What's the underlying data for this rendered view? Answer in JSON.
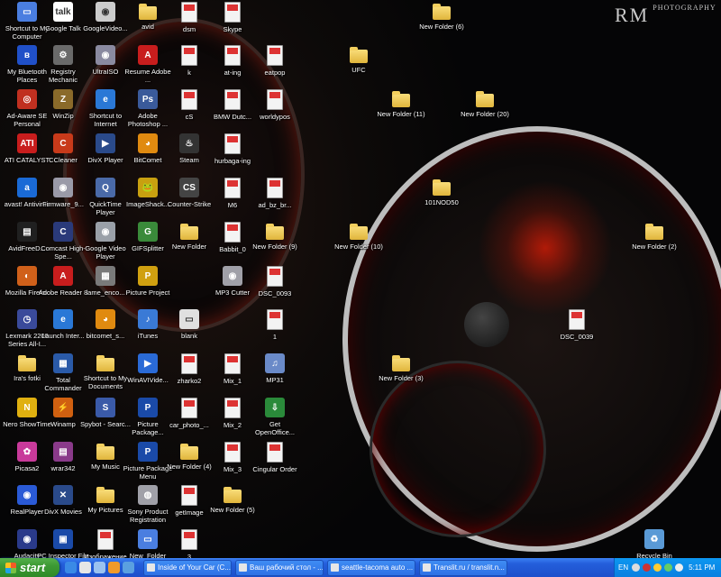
{
  "watermark": {
    "main": "RM",
    "sub": "PHOTOGRAPHY"
  },
  "desktop_icons": [
    {
      "label": "Shortcut to My Computer",
      "icon": "computer-icon",
      "glyph": "▭",
      "color": "#4a7ee0"
    },
    {
      "label": "Google Talk",
      "icon": "google-talk-icon",
      "glyph": "talk",
      "color": "#ffffff"
    },
    {
      "label": "GoogleVideo...",
      "icon": "google-video-icon",
      "glyph": "◉",
      "color": "#cccccc"
    },
    {
      "label": "avid",
      "icon": "folder-icon",
      "glyph": "folder",
      "color": ""
    },
    {
      "label": "dsm",
      "icon": "image-file-icon",
      "glyph": "doc",
      "color": ""
    },
    {
      "label": "Skype",
      "icon": "image-file-icon",
      "glyph": "doc",
      "color": ""
    },
    {
      "label": "New Folder (6)",
      "icon": "folder-icon",
      "glyph": "folder",
      "color": ""
    },
    {
      "label": "My Bluetooth Places",
      "icon": "bluetooth-icon",
      "glyph": "ʙ",
      "color": "#2050c8"
    },
    {
      "label": "Registry Mechanic",
      "icon": "registry-mechanic-icon",
      "glyph": "⚙",
      "color": "#6a6a6a"
    },
    {
      "label": "UltraISO",
      "icon": "ultraiso-icon",
      "glyph": "◉",
      "color": "#8a8aa0"
    },
    {
      "label": "Resume Adobe ...",
      "icon": "pdf-icon",
      "glyph": "A",
      "color": "#c81d1d"
    },
    {
      "label": "k",
      "icon": "image-file-icon",
      "glyph": "doc",
      "color": ""
    },
    {
      "label": "at-ing",
      "icon": "image-file-icon",
      "glyph": "doc",
      "color": ""
    },
    {
      "label": "eatpop",
      "icon": "image-file-icon",
      "glyph": "doc",
      "color": ""
    },
    {
      "label": "UFC",
      "icon": "folder-icon",
      "glyph": "folder",
      "color": ""
    },
    {
      "label": "Ad-Aware SE Personal",
      "icon": "ad-aware-icon",
      "glyph": "◎",
      "color": "#c03020"
    },
    {
      "label": "WinZip",
      "icon": "winzip-icon",
      "glyph": "Z",
      "color": "#8a6a2a"
    },
    {
      "label": "Shortcut to Internet",
      "icon": "internet-explorer-icon",
      "glyph": "e",
      "color": "#2a78d6"
    },
    {
      "label": "Adobe Photoshop ...",
      "icon": "photoshop-icon",
      "glyph": "Ps",
      "color": "#3a5a9a"
    },
    {
      "label": "cS",
      "icon": "image-file-icon",
      "glyph": "doc",
      "color": ""
    },
    {
      "label": "BMW Dutc...",
      "icon": "image-file-icon",
      "glyph": "doc",
      "color": ""
    },
    {
      "label": "worldypos",
      "icon": "image-file-icon",
      "glyph": "doc",
      "color": ""
    },
    {
      "label": "New Folder (11)",
      "icon": "folder-icon",
      "glyph": "folder",
      "color": ""
    },
    {
      "label": "New Folder (20)",
      "icon": "folder-icon",
      "glyph": "folder",
      "color": ""
    },
    {
      "label": "ATI CATALYST",
      "icon": "ati-catalyst-icon",
      "glyph": "ATI",
      "color": "#c81d1d"
    },
    {
      "label": "CCleaner",
      "icon": "ccleaner-icon",
      "glyph": "C",
      "color": "#c83a1a"
    },
    {
      "label": "DivX Player",
      "icon": "divx-icon",
      "glyph": "▶",
      "color": "#2a4a8a"
    },
    {
      "label": "BitComet",
      "icon": "bitcomet-icon",
      "glyph": "◕",
      "color": "#e08a10"
    },
    {
      "label": "Steam",
      "icon": "steam-icon",
      "glyph": "♨",
      "color": "#333333"
    },
    {
      "label": "hurbaga-ing",
      "icon": "image-file-icon",
      "glyph": "doc",
      "color": ""
    },
    {
      "label": "avast! Antivirus",
      "icon": "avast-icon",
      "glyph": "a",
      "color": "#1a6ad6"
    },
    {
      "label": "Firmware_9...",
      "icon": "firmware-icon",
      "glyph": "◉",
      "color": "#9a9aa8"
    },
    {
      "label": "QuickTime Player",
      "icon": "quicktime-icon",
      "glyph": "Q",
      "color": "#4a6aa8"
    },
    {
      "label": "ImageShack...",
      "icon": "imageshack-icon",
      "glyph": "🐸",
      "color": "#c8a010"
    },
    {
      "label": "Counter-Strike",
      "icon": "counter-strike-icon",
      "glyph": "CS",
      "color": "#444444"
    },
    {
      "label": "M6",
      "icon": "image-file-icon",
      "glyph": "doc",
      "color": ""
    },
    {
      "label": "ad_bz_br...",
      "icon": "image-file-icon",
      "glyph": "doc",
      "color": ""
    },
    {
      "label": "101NOD50",
      "icon": "folder-icon",
      "glyph": "folder",
      "color": ""
    },
    {
      "label": "AvidFreeD...",
      "icon": "avid-icon",
      "glyph": "▤",
      "color": "#202020"
    },
    {
      "label": "Comcast High-Spe...",
      "icon": "comcast-icon",
      "glyph": "C",
      "color": "#2a3a7a"
    },
    {
      "label": "Google Video Player",
      "icon": "google-video-player-icon",
      "glyph": "◉",
      "color": "#9aa0a8"
    },
    {
      "label": "GIFSplitter",
      "icon": "gifsplitter-icon",
      "glyph": "G",
      "color": "#3a8a3a"
    },
    {
      "label": "New Folder",
      "icon": "folder-icon",
      "glyph": "folder",
      "color": ""
    },
    {
      "label": "Babbit_0",
      "icon": "image-file-icon",
      "glyph": "doc",
      "color": ""
    },
    {
      "label": "New Folder (9)",
      "icon": "folder-icon",
      "glyph": "folder",
      "color": ""
    },
    {
      "label": "New Folder (10)",
      "icon": "folder-icon",
      "glyph": "folder",
      "color": ""
    },
    {
      "label": "New Folder (2)",
      "icon": "folder-icon",
      "glyph": "folder",
      "color": ""
    },
    {
      "label": "Mozilla Firefox",
      "icon": "firefox-icon",
      "glyph": "◐",
      "color": "#d0601a"
    },
    {
      "label": "Adobe Reader 8",
      "icon": "adobe-reader-icon",
      "glyph": "A",
      "color": "#c81d1d"
    },
    {
      "label": "lame_enco...",
      "icon": "lame-icon",
      "glyph": "▦",
      "color": "#7a7a7a"
    },
    {
      "label": "Picture Project",
      "icon": "picture-project-icon",
      "glyph": "P",
      "color": "#d0a010"
    },
    {
      "label": "MP3 Cutter",
      "icon": "mp3-cutter-icon",
      "glyph": "◉",
      "color": "#a0a0a8"
    },
    {
      "label": "DSC_0093",
      "icon": "image-file-icon",
      "glyph": "doc",
      "color": ""
    },
    {
      "label": "Lexmark 2200 Series All-I...",
      "icon": "lexmark-icon",
      "glyph": "◷",
      "color": "#3a4a9a"
    },
    {
      "label": "Launch Inter...",
      "icon": "launch-internet-icon",
      "glyph": "e",
      "color": "#2a78d6"
    },
    {
      "label": "bitcomet_s...",
      "icon": "bitcomet-setup-icon",
      "glyph": "◕",
      "color": "#e08a10"
    },
    {
      "label": "iTunes",
      "icon": "itunes-icon",
      "glyph": "♪",
      "color": "#3a7ad6"
    },
    {
      "label": "blank",
      "icon": "blank-file-icon",
      "glyph": "▭",
      "color": "#e0e0e0"
    },
    {
      "label": "1",
      "icon": "image-file-icon",
      "glyph": "doc",
      "color": ""
    },
    {
      "label": "DSC_0039",
      "icon": "image-file-icon",
      "glyph": "doc",
      "color": ""
    },
    {
      "label": "Ira's fotki",
      "icon": "folder-icon",
      "glyph": "folder",
      "color": ""
    },
    {
      "label": "Total Commander",
      "icon": "total-commander-icon",
      "glyph": "▦",
      "color": "#2a5aa8"
    },
    {
      "label": "Shortcut to My Documents",
      "icon": "my-documents-icon",
      "glyph": "folder",
      "color": ""
    },
    {
      "label": "WinAVIVide...",
      "icon": "winavi-icon",
      "glyph": "▶",
      "color": "#2a6ad6"
    },
    {
      "label": "zharko2",
      "icon": "image-file-icon",
      "glyph": "doc",
      "color": ""
    },
    {
      "label": "Mix_1",
      "icon": "image-file-icon",
      "glyph": "doc",
      "color": ""
    },
    {
      "label": "MP31",
      "icon": "audio-file-icon",
      "glyph": "♫",
      "color": "#6a8ac8"
    },
    {
      "label": "New Folder (3)",
      "icon": "folder-icon",
      "glyph": "folder",
      "color": ""
    },
    {
      "label": "Nero ShowTime",
      "icon": "nero-icon",
      "glyph": "N",
      "color": "#e0b010"
    },
    {
      "label": "Winamp",
      "icon": "winamp-icon",
      "glyph": "⚡",
      "color": "#d06010"
    },
    {
      "label": "Spybot - Searc...",
      "icon": "spybot-icon",
      "glyph": "S",
      "color": "#3a5aa8"
    },
    {
      "label": "Picture Package...",
      "icon": "picture-package-icon",
      "glyph": "P",
      "color": "#1a4aa8"
    },
    {
      "label": "car_photo_...",
      "icon": "image-file-icon",
      "glyph": "doc",
      "color": ""
    },
    {
      "label": "Mix_2",
      "icon": "image-file-icon",
      "glyph": "doc",
      "color": ""
    },
    {
      "label": "Get OpenOffice...",
      "icon": "openoffice-icon",
      "glyph": "⇩",
      "color": "#2a8a3a"
    },
    {
      "label": "Picasa2",
      "icon": "picasa-icon",
      "glyph": "✿",
      "color": "#c83a9a"
    },
    {
      "label": "wrar342",
      "icon": "winrar-icon",
      "glyph": "▤",
      "color": "#8a3a8a"
    },
    {
      "label": "My Music",
      "icon": "my-music-icon",
      "glyph": "folder",
      "color": ""
    },
    {
      "label": "Picture Package Menu",
      "icon": "picture-package-menu-icon",
      "glyph": "P",
      "color": "#1a4aa8"
    },
    {
      "label": "New Folder (4)",
      "icon": "folder-icon",
      "glyph": "folder",
      "color": ""
    },
    {
      "label": "Mix_3",
      "icon": "image-file-icon",
      "glyph": "doc",
      "color": ""
    },
    {
      "label": "Cingular Order",
      "icon": "image-file-icon",
      "glyph": "doc",
      "color": ""
    },
    {
      "label": "RealPlayer",
      "icon": "realplayer-icon",
      "glyph": "◉",
      "color": "#2a5ad6"
    },
    {
      "label": "DivX Movies",
      "icon": "divx-movies-icon",
      "glyph": "✕",
      "color": "#2a4a8a"
    },
    {
      "label": "My Pictures",
      "icon": "my-pictures-icon",
      "glyph": "folder",
      "color": ""
    },
    {
      "label": "Sony Product Registration",
      "icon": "sony-icon",
      "glyph": "◍",
      "color": "#a0a0a8"
    },
    {
      "label": "getImage",
      "icon": "image-file-icon",
      "glyph": "doc",
      "color": ""
    },
    {
      "label": "New Folder (5)",
      "icon": "folder-icon",
      "glyph": "folder",
      "color": ""
    },
    {
      "label": "Audacity",
      "icon": "audacity-icon",
      "glyph": "◉",
      "color": "#2a3a8a"
    },
    {
      "label": "PC Inspector File Recovery",
      "icon": "pc-inspector-icon",
      "glyph": "▣",
      "color": "#1a4aa8"
    },
    {
      "label": "Изображение 099",
      "icon": "image-file-icon",
      "glyph": "doc",
      "color": ""
    },
    {
      "label": "New_Folder",
      "icon": "new-folder-file-icon",
      "glyph": "▭",
      "color": "#4a7ee0"
    },
    {
      "label": "3",
      "icon": "image-file-icon",
      "glyph": "doc",
      "color": ""
    },
    {
      "label": "Recycle Bin",
      "icon": "recycle-bin-icon",
      "glyph": "♻",
      "color": "#5a9ad6"
    }
  ],
  "taskbar": {
    "start_label": "start",
    "tasks": [
      "Inside of Your Car (C...",
      "Ваш рабочий стол - ...",
      "seattle-tacoma auto ...",
      "Translit.ru / translit.n..."
    ],
    "tray": {
      "lang": "EN",
      "time": "5:11 PM"
    }
  }
}
